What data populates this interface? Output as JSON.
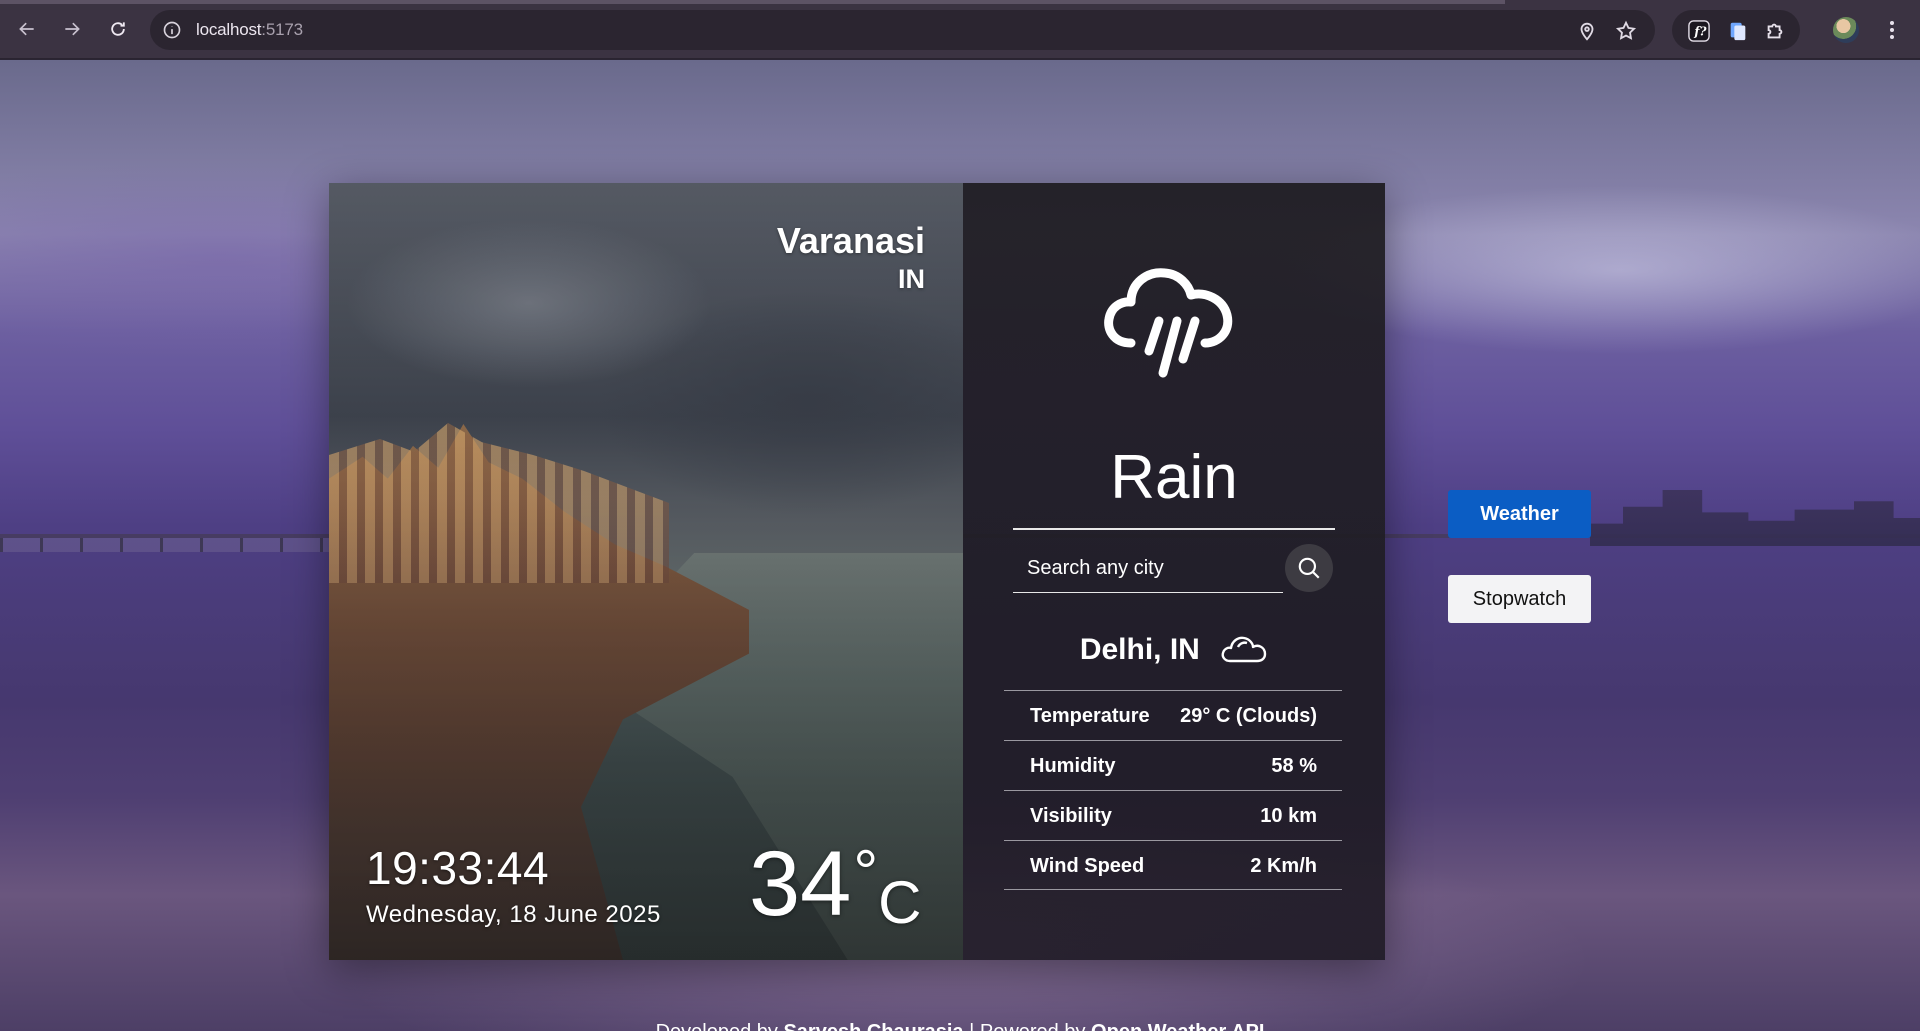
{
  "browser": {
    "url_host": "localhost",
    "url_port": ":5173"
  },
  "card": {
    "city": "Varanasi",
    "country": "IN",
    "time": "19:33:44",
    "date": "Wednesday, 18 June 2025",
    "temperature_value": "34",
    "temperature_unit": "°",
    "temperature_scale": "C"
  },
  "panel": {
    "condition": "Rain",
    "condition_icon": "rain-cloud-icon",
    "search_placeholder": "Search any city",
    "location": "Delhi, IN",
    "location_icon": "cloud-icon",
    "details": [
      {
        "label": "Temperature",
        "value": "29° C (Clouds)"
      },
      {
        "label": "Humidity",
        "value": "58 %"
      },
      {
        "label": "Visibility",
        "value": "10 km"
      },
      {
        "label": "Wind Speed",
        "value": "2 Km/h"
      }
    ]
  },
  "side_nav": {
    "weather_label": "Weather",
    "stopwatch_label": "Stopwatch",
    "active": "Weather"
  },
  "footer": {
    "prefix": "Developed by ",
    "author": "Sarvesh Chaurasia",
    "separator": " | Powered by ",
    "api": "Open Weather API"
  },
  "colors": {
    "accent": "#0b5dc4",
    "panel_bg": "#1d1b20"
  }
}
